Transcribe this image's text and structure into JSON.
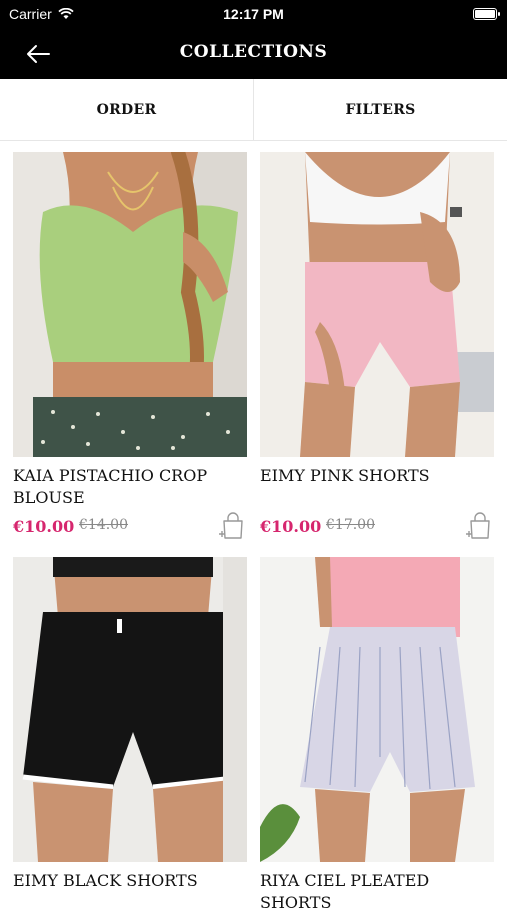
{
  "status_bar": {
    "carrier": "Carrier",
    "time": "12:17 PM",
    "battery_level": 1.0
  },
  "nav": {
    "title": "COLLECTIONS"
  },
  "toolbar": {
    "order_label": "ORDER",
    "filters_label": "FILTERS"
  },
  "products": [
    {
      "name": "KAIA PISTACHIO CROP BLOUSE",
      "price": "€10.00",
      "old_price": "€14.00"
    },
    {
      "name": "EIMY PINK SHORTS",
      "price": "€10.00",
      "old_price": "€17.00"
    },
    {
      "name": "EIMY BLACK SHORTS"
    },
    {
      "name": "RIYA CIEL PLEATED SHORTS"
    }
  ],
  "colors": {
    "accent_price": "#d6266e",
    "bar_background": "#000000"
  }
}
